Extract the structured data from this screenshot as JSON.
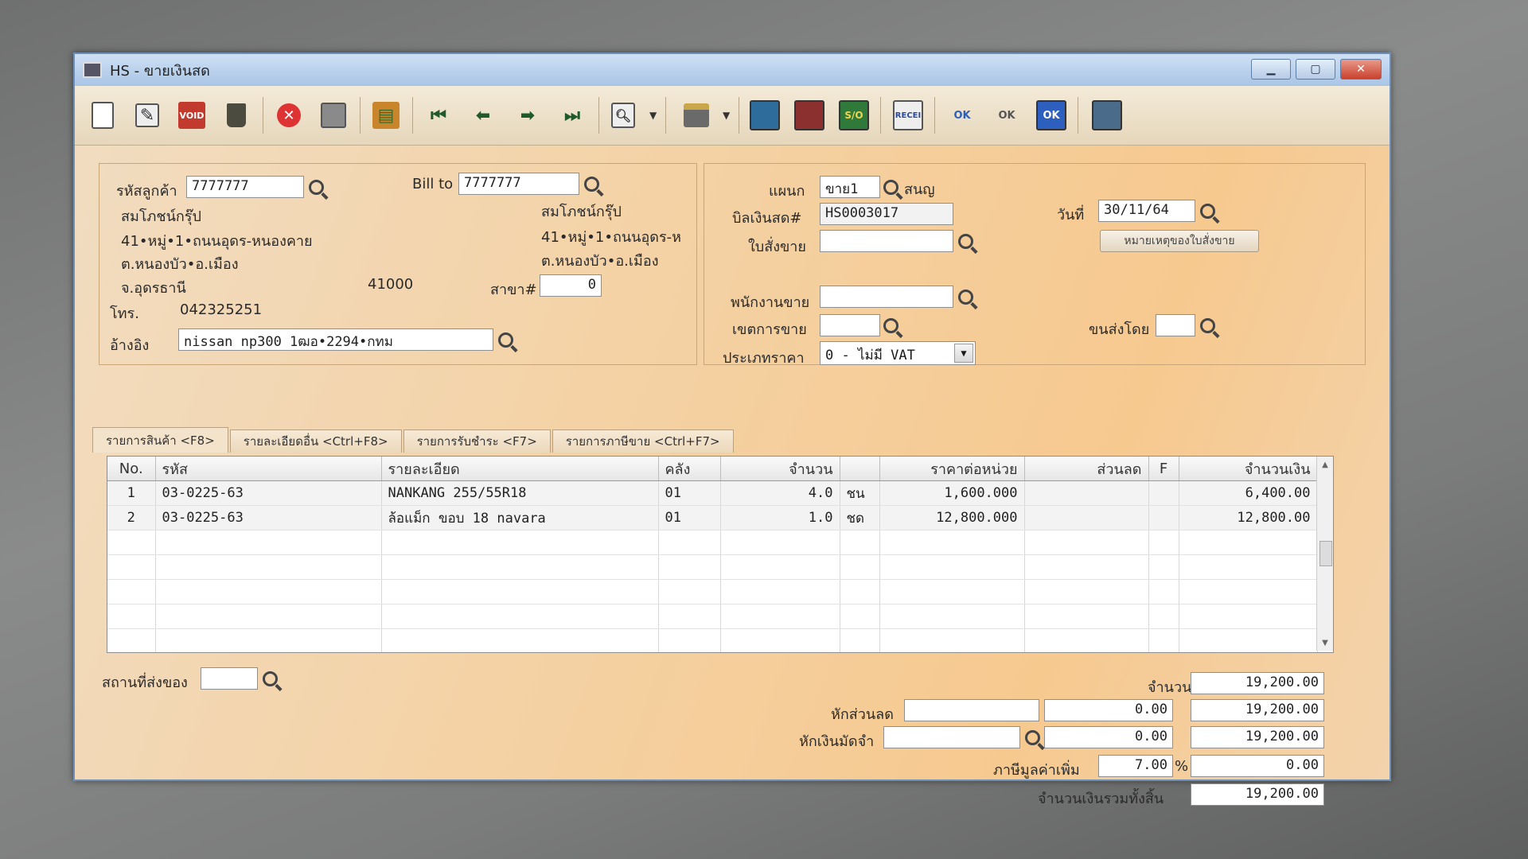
{
  "window": {
    "title": "HS - ขายเงินสด"
  },
  "toolbar": {
    "buttons": [
      "new",
      "edit",
      "void",
      "delete",
      "cancel",
      "save",
      "post",
      "first",
      "prev",
      "next",
      "last",
      "find",
      "print",
      "report1",
      "report2",
      "report3",
      "report4",
      "approve",
      "unapprove",
      "ok",
      "export"
    ]
  },
  "customer": {
    "code_label": "รหัสลูกค้า",
    "code": "7777777",
    "name": "สมโภชน์กรุ๊ป",
    "addr1": "41•หมู่•1•ถนนอุดร-หนองคาย",
    "addr2": "ต.หนองบัว•อ.เมือง",
    "addr3": "จ.อุดรธานี",
    "zip": "41000",
    "tel_label": "โทร.",
    "tel": "042325251",
    "ref_label": "อ้างอิง",
    "ref": "nissan np300 1ฒอ•2294•กทม"
  },
  "billto": {
    "label": "Bill to",
    "code": "7777777",
    "name": "สมโภชน์กรุ๊ป",
    "addr1": "41•หมู่•1•ถนนอุดร-ห",
    "addr2": "ต.หนองบัว•อ.เมือง",
    "branch_label": "สาขา#",
    "branch": "0"
  },
  "doc": {
    "dept_label": "แผนก",
    "dept": "ขาย1",
    "dept_name": "สนญ",
    "bill_label": "บิลเงินสด#",
    "bill_no": "HS0003017",
    "so_label": "ใบสั่งขาย",
    "so": "",
    "date_label": "วันที่",
    "date": "30/11/64",
    "note_button": "หมายเหตุของใบสั่งขาย",
    "salesman_label": "พนักงานขาย",
    "area_label": "เขตการขาย",
    "ship_label": "ขนส่งโดย",
    "price_type_label": "ประเภทราคา",
    "price_type": "0 - ไม่มี VAT"
  },
  "tabs": [
    "รายการสินค้า <F8>",
    "รายละเอียดอื่น <Ctrl+F8>",
    "รายการรับชำระ <F7>",
    "รายการภาษีขาย <Ctrl+F7>"
  ],
  "grid": {
    "headers": [
      "No.",
      "รหัส",
      "รายละเอียด",
      "คลัง",
      "จำนวน",
      "",
      "ราคาต่อหน่วย",
      "ส่วนลด",
      "F",
      "จำนวนเงิน"
    ],
    "rows": [
      {
        "no": "1",
        "code": "03-0225-63",
        "desc": "NANKANG 255/55R18",
        "wh": "01",
        "qty": "4.0",
        "unit": "ชน",
        "price": "1,600.000",
        "disc": "",
        "f": "",
        "amount": "6,400.00"
      },
      {
        "no": "2",
        "code": "03-0225-63",
        "desc": "ล้อแม็ก ขอบ 18 navara",
        "wh": "01",
        "qty": "1.0",
        "unit": "ชด",
        "price": "12,800.000",
        "disc": "",
        "f": "",
        "amount": "12,800.00"
      }
    ]
  },
  "footer": {
    "ship_place_label": "สถานที่ส่งของ",
    "amount_label": "จำนวนเงิน",
    "amount": "19,200.00",
    "discount_label": "หักส่วนลด",
    "discount": "0.00",
    "after_discount": "19,200.00",
    "deposit_label": "หักเงินมัดจำ",
    "deposit": "0.00",
    "after_deposit": "19,200.00",
    "vat_label": "ภาษีมูลค่าเพิ่ม",
    "vat_rate": "7.00",
    "vat_pct": "%",
    "vat_amount": "0.00",
    "total_label": "จำนวนเงินรวมทั้งสิ้น",
    "total": "19,200.00"
  }
}
